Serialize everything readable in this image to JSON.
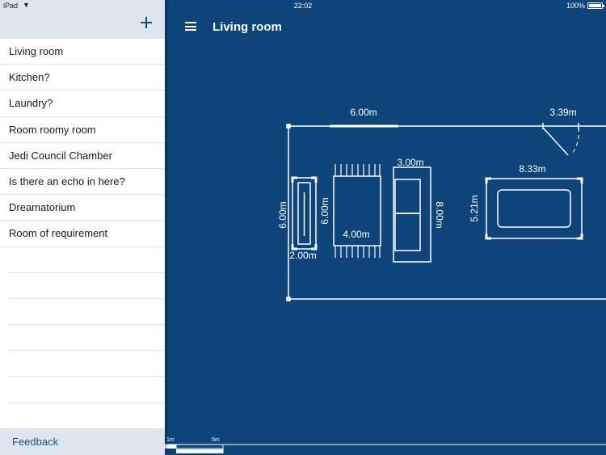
{
  "status": {
    "device": "iPad",
    "time": "22:02",
    "battery": "100%"
  },
  "sidebar": {
    "rooms": [
      {
        "label": "Living room"
      },
      {
        "label": "Kitchen?"
      },
      {
        "label": "Laundry?"
      },
      {
        "label": "Room roomy room"
      },
      {
        "label": "Jedi Council Chamber"
      },
      {
        "label": "Is there an echo in here?"
      },
      {
        "label": "Dreamatorium"
      },
      {
        "label": "Room of requirement"
      }
    ],
    "feedback_label": "Feedback"
  },
  "header": {
    "title": "Living room"
  },
  "plan": {
    "top_wall_label": "6.00m",
    "door_label": "3.39m",
    "left_wall_label": "6.00m",
    "item_1_length": "6.00m",
    "item_1_width": "2.00m",
    "table_length": "6.00m",
    "table_width": "4.00m",
    "sofa_width": "3.00m",
    "sofa_length": "8.00m",
    "bath_width": "8.33m",
    "bath_length": "5.21m"
  },
  "scale": {
    "small": "1m",
    "large": "5m"
  },
  "colors": {
    "background": "#0d4479",
    "sidebar_header": "#dde6ef",
    "accent": "#1a4f86"
  }
}
